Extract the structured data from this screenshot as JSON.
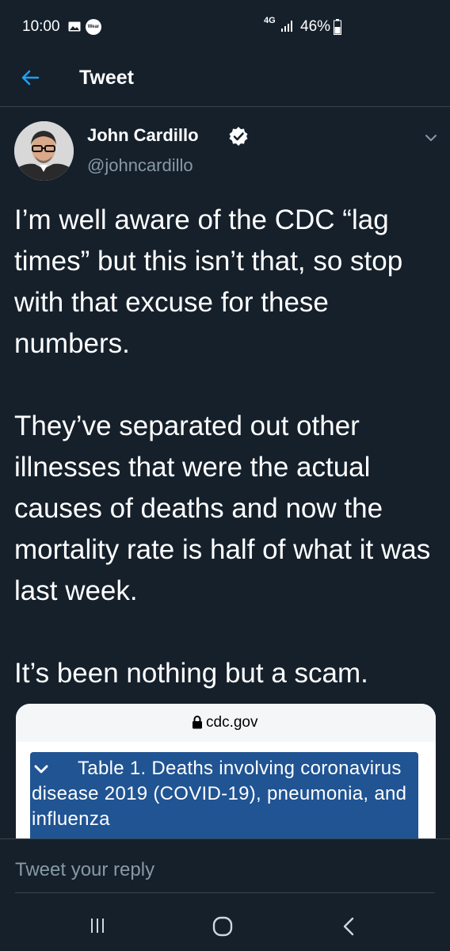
{
  "status_bar": {
    "time": "10:00",
    "wear_label": "Wear",
    "network": "4G",
    "battery": "46%"
  },
  "header": {
    "title": "Tweet"
  },
  "tweet": {
    "author_name": "John Cardillo",
    "author_handle": "@johncardillo",
    "paragraphs": [
      "I’m well aware of the CDC “lag times” but this isn’t that, so stop with that excuse for these numbers.",
      "They’ve separated out other illnesses that were the actual causes of deaths and now the mortality rate is half of what it was last week.",
      "It’s been nothing but a scam."
    ]
  },
  "embed": {
    "url": "cdc.gov",
    "table_title": "Table 1. Deaths involving coronavirus disease 2019 (COVID-19), pneumonia, and influenza"
  },
  "reply": {
    "placeholder": "Tweet your reply"
  },
  "colors": {
    "background": "#15202b",
    "accent": "#1da1f2",
    "muted": "#8899a6",
    "cdc_blue": "#205493"
  }
}
